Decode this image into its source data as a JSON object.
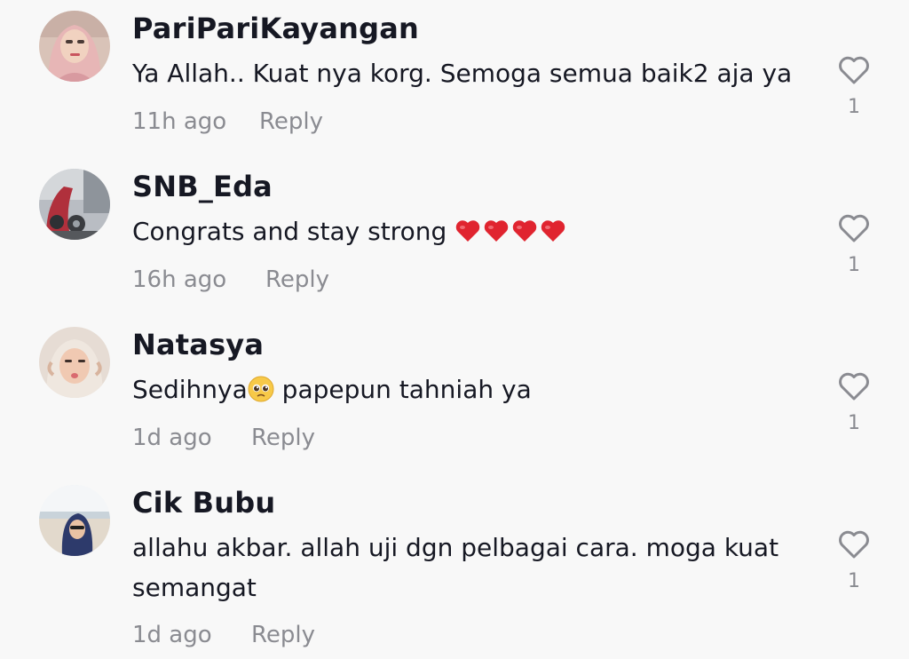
{
  "colors": {
    "background": "#f8f8f8",
    "username": "#161823",
    "text": "#161823",
    "meta": "#8a8b91",
    "heart_outline": "#8a8b91",
    "emoji_heart": "#e0242f"
  },
  "icons": {
    "like": "heart-outline-icon",
    "red_heart": "red-heart-emoji",
    "pleading_face": "pleading-face-emoji"
  },
  "comments": [
    {
      "username": "PariPariKayangan",
      "text": "Ya Allah.. Kuat nya korg. Semoga semua baik2 aja ya",
      "time": "11h ago",
      "reply_label": "Reply",
      "likes": "1"
    },
    {
      "username": "SNB_Eda",
      "text": "Congrats and stay strong ",
      "emoji_suffix": "❤️❤️❤️❤️",
      "time": "16h ago",
      "reply_label": "Reply",
      "likes": "1"
    },
    {
      "username": "Natasya",
      "text_before": "Sedihnya",
      "emoji_inline": "🥺",
      "text_after": " papepun tahniah ya",
      "time": "1d ago",
      "reply_label": "Reply",
      "likes": "1"
    },
    {
      "username": "Cik Bubu",
      "text": "allahu akbar. allah uji dgn pelbagai cara. moga kuat semangat",
      "time": "1d ago",
      "reply_label": "Reply",
      "likes": "1"
    }
  ]
}
